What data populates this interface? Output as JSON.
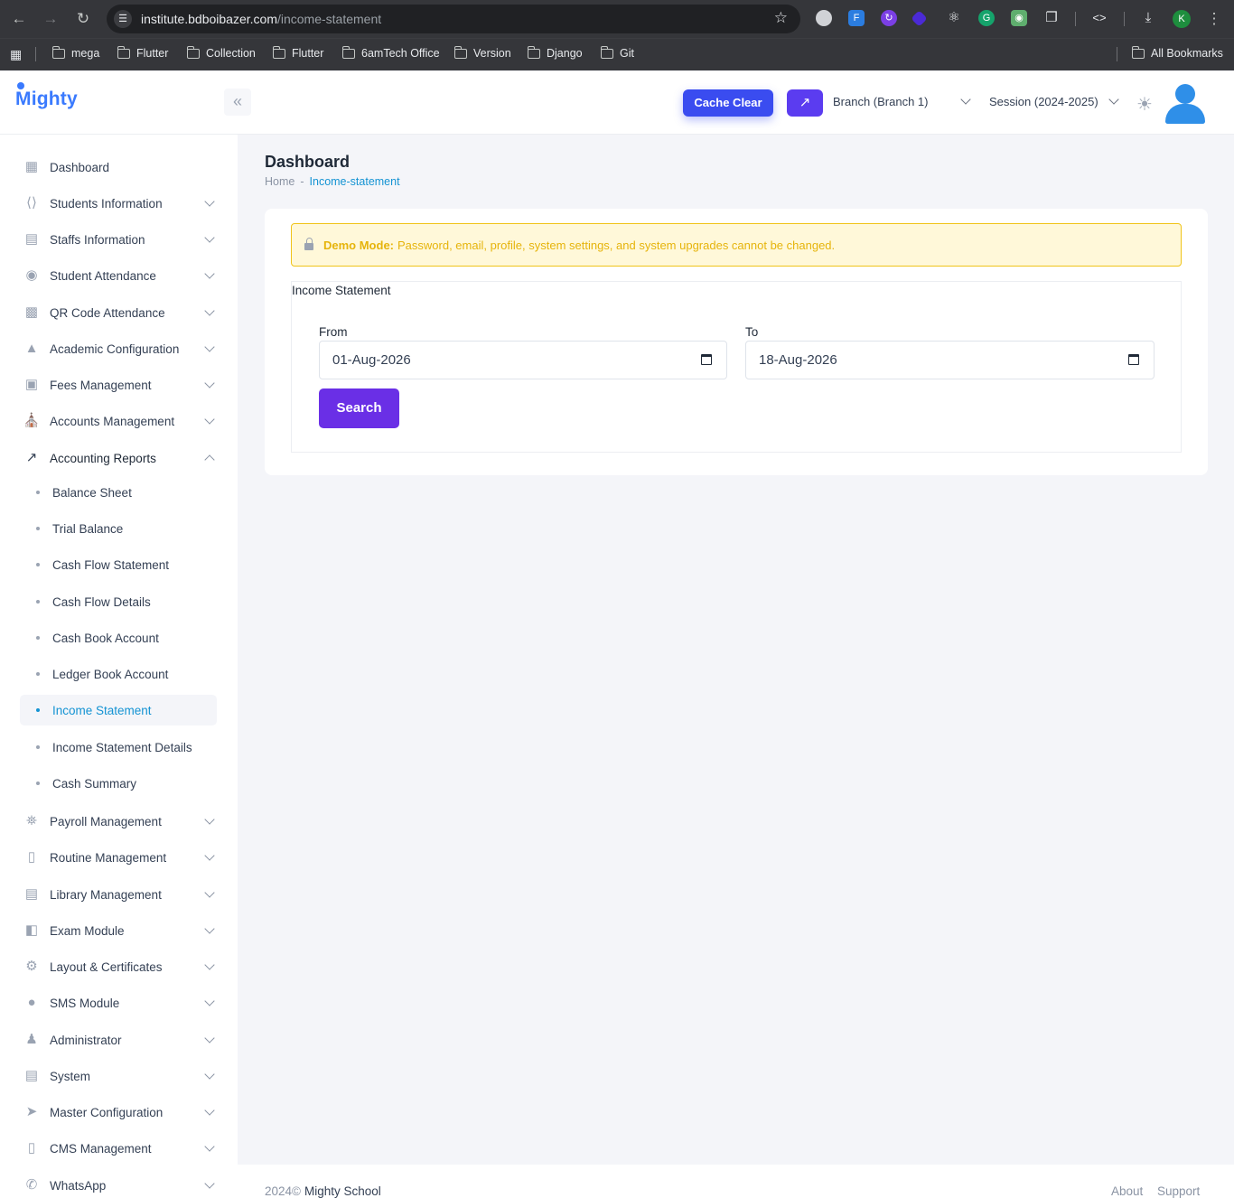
{
  "browser": {
    "url_host": "institute.bdboibazer.com",
    "url_path": "/income-statement",
    "profile_initial": "K",
    "bookmarks": [
      "mega",
      "Flutter",
      "Collection",
      "Flutter",
      "6amTech Office",
      "Version",
      "Django",
      "Git"
    ],
    "all_bookmarks": "All Bookmarks"
  },
  "header": {
    "logo": "Mighty",
    "cache_clear": "Cache Clear",
    "branch": "Branch (Branch 1)",
    "session": "Session (2024-2025)"
  },
  "sidebar": {
    "items": [
      {
        "label": "Dashboard",
        "icon": "dashboard-icon"
      },
      {
        "label": "Students Information",
        "icon": "code-icon"
      },
      {
        "label": "Staffs Information",
        "icon": "id-card-icon"
      },
      {
        "label": "Student Attendance",
        "icon": "fingerprint-icon"
      },
      {
        "label": "QR Code Attendance",
        "icon": "qr-code-icon"
      },
      {
        "label": "Academic Configuration",
        "icon": "triangle-icon"
      },
      {
        "label": "Fees Management",
        "icon": "money-icon"
      },
      {
        "label": "Accounts Management",
        "icon": "bank-icon"
      },
      {
        "label": "Accounting Reports",
        "icon": "chart-line-icon"
      }
    ],
    "sub_items": [
      "Balance Sheet",
      "Trial Balance",
      "Cash Flow Statement",
      "Cash Flow Details",
      "Cash Book Account",
      "Ledger Book Account",
      "Income Statement",
      "Income Statement Details",
      "Cash Summary"
    ],
    "items_after": [
      {
        "label": "Payroll Management",
        "icon": "payroll-icon"
      },
      {
        "label": "Routine Management",
        "icon": "map-icon"
      },
      {
        "label": "Library Management",
        "icon": "book-icon"
      },
      {
        "label": "Exam Module",
        "icon": "layout-icon"
      },
      {
        "label": "Layout & Certificates",
        "icon": "gear-badge-icon"
      },
      {
        "label": "SMS Module",
        "icon": "sms-icon"
      },
      {
        "label": "Administrator",
        "icon": "admin-icon"
      },
      {
        "label": "System",
        "icon": "server-icon"
      },
      {
        "label": "Master Configuration",
        "icon": "rocket-icon"
      },
      {
        "label": "CMS Management",
        "icon": "map-icon"
      },
      {
        "label": "WhatsApp",
        "icon": "whatsapp-icon"
      }
    ]
  },
  "main": {
    "title": "Dashboard",
    "breadcrumb_home": "Home",
    "breadcrumb_sep": "-",
    "breadcrumb_current": "Income-statement",
    "alert_bold": "Demo Mode:",
    "alert_text": "Password, email, profile, system settings, and system upgrades cannot be changed.",
    "section_title": "Income Statement",
    "from_label": "From",
    "from_value": "01-Aug-2026",
    "to_label": "To",
    "to_value": "18-Aug-2026",
    "search_button": "Search"
  },
  "footer": {
    "copyright": "2024©",
    "brand": "Mighty School",
    "about": "About",
    "support": "Support"
  },
  "colors": {
    "primary": "#6a2fe6",
    "cache_button": "#3a4cf0",
    "link": "#1493d3",
    "alert_text": "#e6b40b"
  }
}
